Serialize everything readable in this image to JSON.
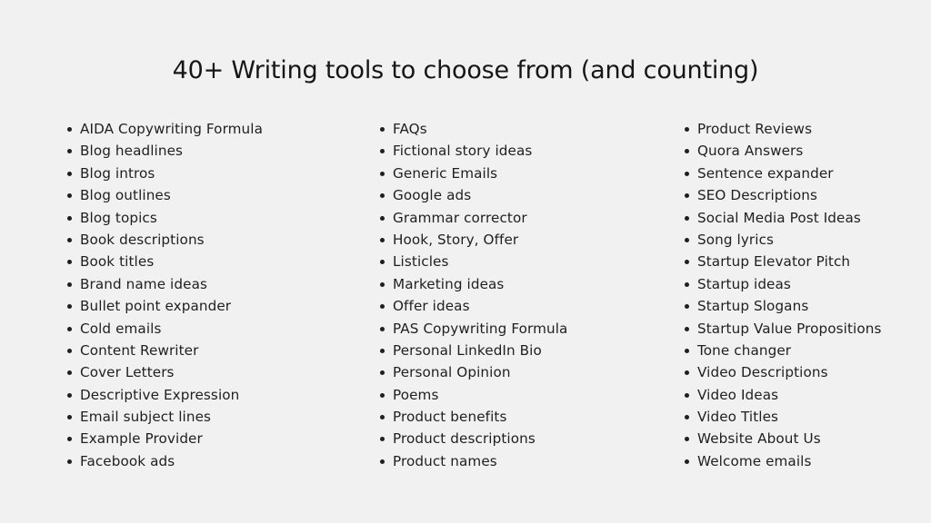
{
  "title": "40+ Writing tools to choose from (and counting)",
  "colors": {
    "background": "#f1f1f1",
    "text": "#1f1f1f"
  },
  "columns": [
    {
      "items": [
        "AIDA Copywriting Formula",
        "Blog headlines",
        "Blog intros",
        "Blog outlines",
        "Blog topics",
        "Book descriptions",
        "Book titles",
        "Brand name ideas",
        "Bullet point expander",
        "Cold emails",
        "Content Rewriter",
        "Cover Letters",
        "Descriptive Expression",
        "Email subject lines",
        "Example Provider",
        "Facebook ads"
      ]
    },
    {
      "items": [
        "FAQs",
        "Fictional story ideas",
        "Generic Emails",
        "Google ads",
        "Grammar corrector",
        "Hook, Story, Offer",
        "Listicles",
        "Marketing ideas",
        "Offer ideas",
        "PAS Copywriting Formula",
        "Personal LinkedIn Bio",
        "Personal Opinion",
        "Poems",
        "Product benefits",
        "Product descriptions",
        "Product names"
      ]
    },
    {
      "items": [
        "Product Reviews",
        "Quora Answers",
        "Sentence expander",
        "SEO Descriptions",
        "Social Media Post Ideas",
        "Song lyrics",
        "Startup Elevator Pitch",
        "Startup ideas",
        "Startup Slogans",
        "Startup Value Propositions",
        "Tone changer",
        "Video Descriptions",
        "Video Ideas",
        "Video Titles",
        "Website About Us",
        "Welcome emails"
      ]
    }
  ]
}
